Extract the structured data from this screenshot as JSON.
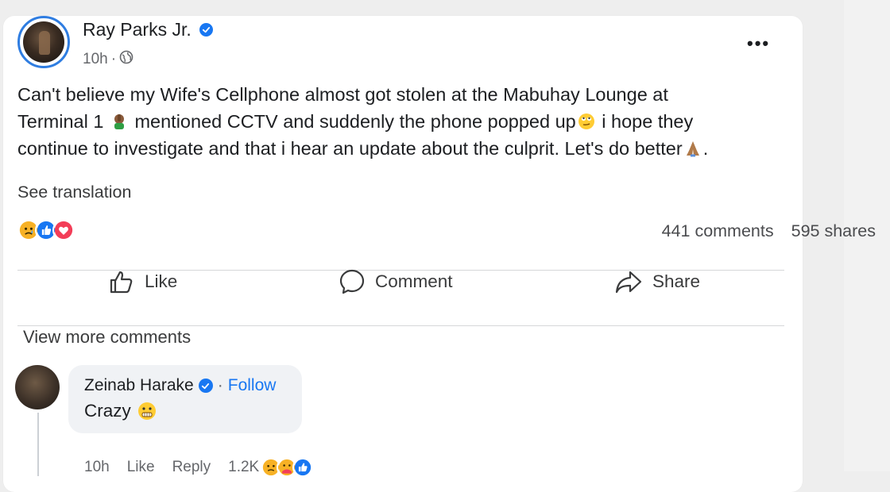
{
  "post": {
    "author": "Ray Parks Jr.",
    "time": "10h",
    "separator": "·",
    "text_line1": "Can't believe my Wife's Cellphone almost got stolen at the Mabuhay Lounge at",
    "text_line2a": "Terminal 1",
    "text_line2b": "mentioned CCTV and suddenly the phone popped up",
    "text_line2c": "i hope they",
    "text_line3a": "continue to investigate and that i hear an update about the culprit. Let's do better",
    "text_line3b": ".",
    "see_translation": "See translation",
    "comments_count": "441 comments",
    "shares_count": "595 shares",
    "reactions": [
      "sad",
      "like",
      "love"
    ]
  },
  "actions": {
    "like": "Like",
    "comment": "Comment",
    "share": "Share"
  },
  "comments_section": {
    "view_more": "View more comments",
    "comment": {
      "author": "Zeinab Harake",
      "separator": "·",
      "follow": "Follow",
      "text": "Crazy",
      "time": "10h",
      "like": "Like",
      "reply": "Reply",
      "reaction_count": "1.2K",
      "reactions": [
        "sad",
        "care",
        "like"
      ]
    }
  },
  "colors": {
    "accent": "#1877f2",
    "avatar_ring": "#2f7de1",
    "love": "#f33e58",
    "sad": "#f7b125"
  }
}
